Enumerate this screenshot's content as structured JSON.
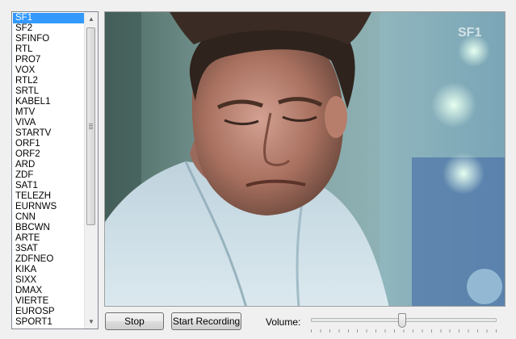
{
  "channels": {
    "selected_index": 0,
    "items": [
      "SF1",
      "SF2",
      "SFINFO",
      "RTL",
      "PRO7",
      "VOX",
      "RTL2",
      "SRTL",
      "KABEL1",
      "MTV",
      "VIVA",
      "STARTV",
      "ORF1",
      "ORF2",
      "ARD",
      "ZDF",
      "SAT1",
      "TELEZH",
      "EURNWS",
      "CNN",
      "BBCWN",
      "ARTE",
      "3SAT",
      "ZDFNEO",
      "KIKA",
      "SIXX",
      "DMAX",
      "VIERTE",
      "EUROSP",
      "SPORT1"
    ]
  },
  "video": {
    "watermark": "SF1"
  },
  "controls": {
    "stop_label": "Stop",
    "record_label": "Start Recording",
    "volume_label": "Volume:",
    "volume_level": 0.49
  }
}
